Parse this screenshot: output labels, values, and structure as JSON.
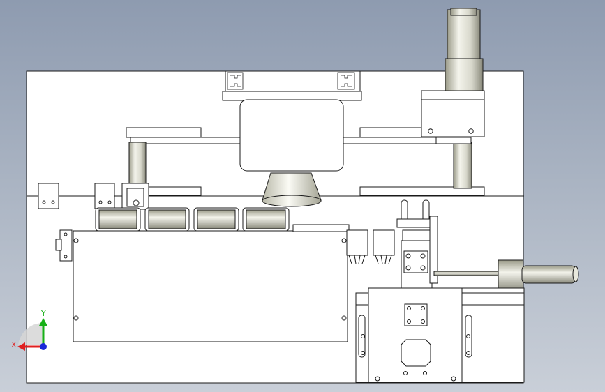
{
  "view": {
    "background_top": "#8e9bb0",
    "background_bottom": "#c9cfd8",
    "line_color": "#1a1a1a",
    "part_fill": "#ffffff"
  },
  "triad": {
    "x_label": "X",
    "y_label": "Y",
    "x_color": "#e02020",
    "y_color": "#18b018",
    "z_color": "#1a28d8"
  }
}
